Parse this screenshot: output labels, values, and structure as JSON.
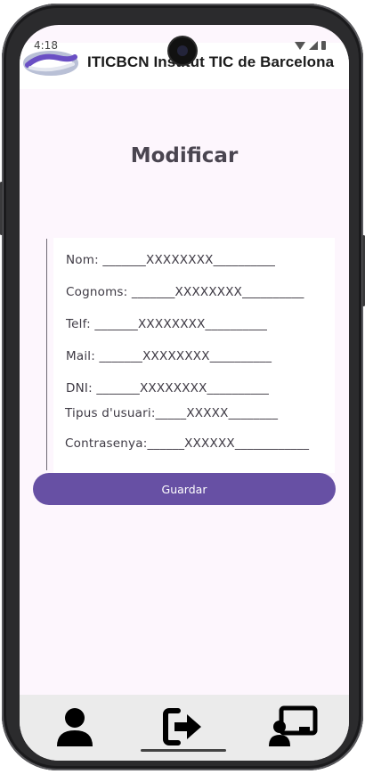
{
  "status_bar": {
    "time": "4:18"
  },
  "header": {
    "title": "ITICBCN Institut TIC de Barcelona",
    "logo_icon": "iticbcn-logo"
  },
  "page": {
    "title": "Modificar"
  },
  "form": {
    "fields": [
      {
        "label": "Nom: _______XXXXXXXX__________"
      },
      {
        "label": "Cognoms: _______XXXXXXXX__________"
      },
      {
        "label": "Telf: _______XXXXXXXX__________"
      },
      {
        "label": "Mail: _______XXXXXXXX__________"
      },
      {
        "label": "DNI: _______XXXXXXXX__________"
      },
      {
        "label": "Tipus d'usuari:_____XXXXX________"
      },
      {
        "label": "Contrasenya:______XXXXXX____________"
      }
    ],
    "save_label": "Guardar"
  },
  "bottom_nav": {
    "items": [
      {
        "icon": "user-icon"
      },
      {
        "icon": "logout-icon"
      },
      {
        "icon": "presentation-user-icon"
      }
    ]
  },
  "colors": {
    "accent": "#6750a4",
    "background": "#fdf6fd",
    "nav_bg": "#ebebeb"
  }
}
